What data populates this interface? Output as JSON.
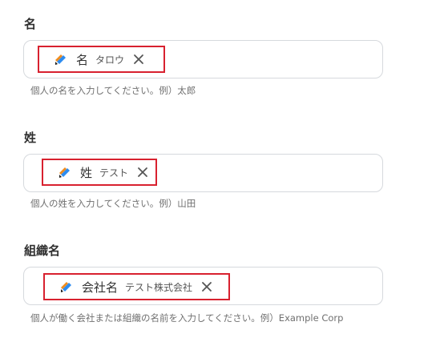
{
  "fields": [
    {
      "label": "名",
      "token_name": "名",
      "token_value": "タロウ",
      "help": "個人の名を入力してください。例）太郎",
      "token_icon": "app-logo-icon",
      "remove_icon": "close-icon"
    },
    {
      "label": "姓",
      "token_name": "姓",
      "token_value": "テスト",
      "help": "個人の姓を入力してください。例）山田",
      "token_icon": "app-logo-icon",
      "remove_icon": "close-icon"
    },
    {
      "label": "組織名",
      "token_name": "会社名",
      "token_value": "テスト株式会社",
      "help": "個人が働く会社または組織の名前を入力してください。例）Example Corp",
      "token_icon": "app-logo-icon",
      "remove_icon": "close-icon"
    }
  ],
  "colors": {
    "highlight_border": "#d8212f",
    "input_border": "#d6d9dd",
    "logo_blue": "#2d8cf0",
    "logo_orange": "#f08c1e",
    "logo_black": "#1a1a1a"
  }
}
